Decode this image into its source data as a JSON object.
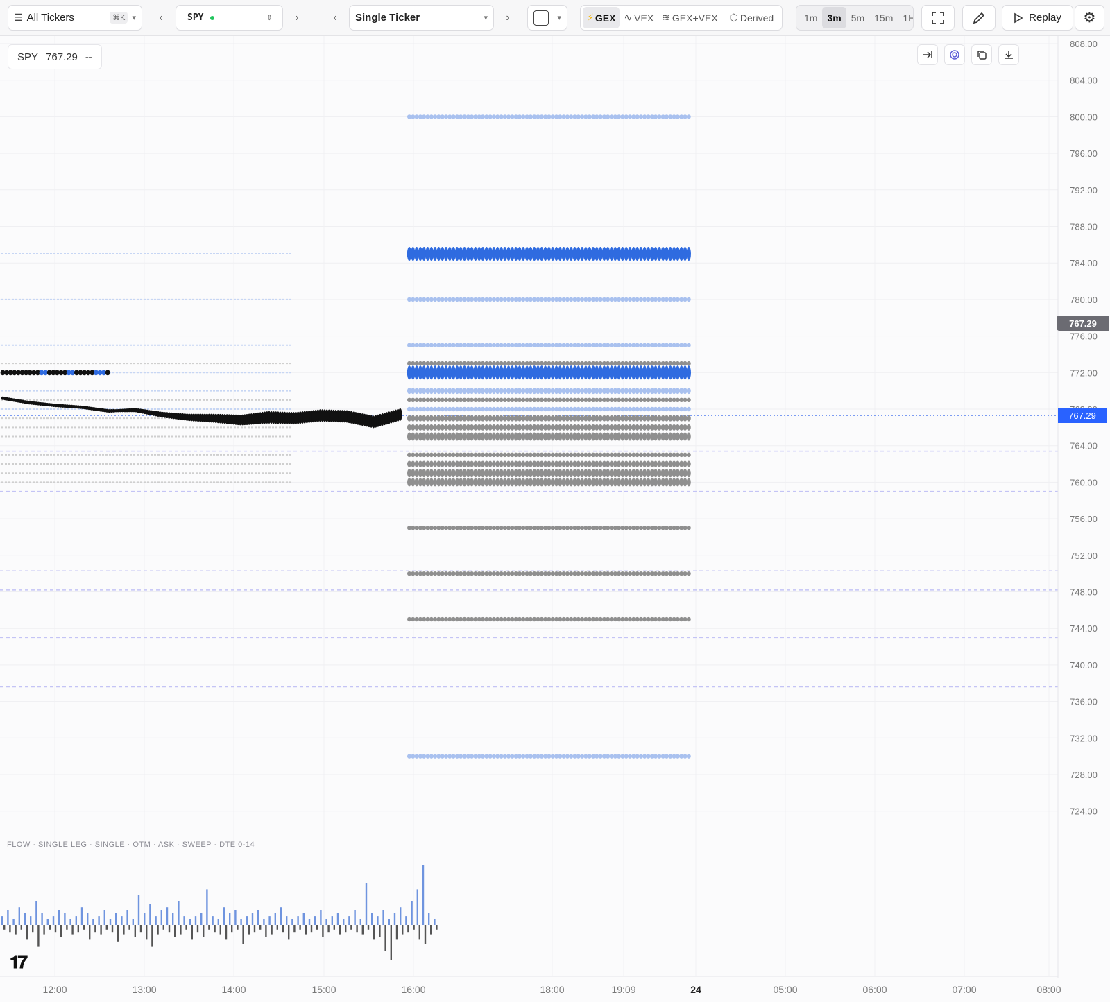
{
  "toolbar": {
    "tickers_label": "All Tickers",
    "tickers_shortcut": "⌘K",
    "symbol": "SPY",
    "view_mode": "Single Ticker",
    "modes": [
      "GEX",
      "VEX",
      "GEX+VEX",
      "Derived"
    ],
    "active_mode": "GEX",
    "timeframes": [
      "1m",
      "3m",
      "5m",
      "15m",
      "1H"
    ],
    "active_timeframe": "3m",
    "replay_label": "Replay"
  },
  "legend": {
    "symbol": "SPY",
    "price": "767.29",
    "change": "--"
  },
  "price_tag_last": "767.29",
  "price_tag_current": "767.29",
  "flow_label": "FLOW · SINGLE LEG · SINGLE · OTM · ASK · SWEEP · DTE 0-14",
  "logo_text": "TV",
  "colors": {
    "accent_blue": "#2962ff",
    "gex_positive_strong": "#2f6be0",
    "gex_positive_light": "#a9c1ef",
    "gex_negative": "#8f8f8f",
    "price_line": "#111111",
    "flow_call": "#6f94df",
    "flow_put": "#555555"
  },
  "chart_data": {
    "type": "scatter",
    "y_axis_ticks": [
      "808.00",
      "804.00",
      "800.00",
      "796.00",
      "792.00",
      "788.00",
      "784.00",
      "780.00",
      "776.00",
      "772.00",
      "768.00",
      "764.00",
      "760.00",
      "756.00",
      "752.00",
      "748.00",
      "744.00",
      "740.00",
      "736.00",
      "732.00",
      "728.00",
      "724.00"
    ],
    "x_axis_ticks": [
      "12:00",
      "13:00",
      "14:00",
      "15:00",
      "16:00",
      "18:00",
      "19:09",
      "24",
      "05:00",
      "06:00",
      "07:00",
      "08:00"
    ],
    "ylim": [
      720,
      810
    ],
    "current_price": 767.29,
    "dashed_levels": [
      763.4,
      759.0,
      750.3,
      748.2,
      743.0,
      737.6
    ],
    "gex_levels": [
      {
        "strike": 800,
        "sign": "pos",
        "size": 2
      },
      {
        "strike": 785,
        "sign": "pos",
        "size": 5
      },
      {
        "strike": 780,
        "sign": "pos",
        "size": 2
      },
      {
        "strike": 775,
        "sign": "pos",
        "size": 2
      },
      {
        "strike": 773,
        "sign": "neg",
        "size": 2
      },
      {
        "strike": 772,
        "sign": "pos",
        "size": 5
      },
      {
        "strike": 770,
        "sign": "pos",
        "size": 3
      },
      {
        "strike": 769,
        "sign": "neg",
        "size": 2
      },
      {
        "strike": 768,
        "sign": "pos",
        "size": 2
      },
      {
        "strike": 767,
        "sign": "neg",
        "size": 3
      },
      {
        "strike": 766,
        "sign": "neg",
        "size": 3
      },
      {
        "strike": 765,
        "sign": "neg",
        "size": 4
      },
      {
        "strike": 763,
        "sign": "neg",
        "size": 2
      },
      {
        "strike": 762,
        "sign": "neg",
        "size": 3
      },
      {
        "strike": 761,
        "sign": "neg",
        "size": 4
      },
      {
        "strike": 760,
        "sign": "neg",
        "size": 4
      },
      {
        "strike": 755,
        "sign": "neg",
        "size": 2
      },
      {
        "strike": 750,
        "sign": "neg",
        "size": 2
      },
      {
        "strike": 745,
        "sign": "neg",
        "size": 2
      },
      {
        "strike": 730,
        "sign": "pos",
        "size": 2
      }
    ],
    "price_path": [
      769.2,
      768.7,
      768.4,
      768.2,
      767.8,
      767.9,
      767.4,
      767.1,
      767.0,
      766.8,
      767.1,
      767.0,
      767.3,
      767.2,
      766.6,
      767.4
    ],
    "flow_series": {
      "call": [
        3,
        5,
        2,
        6,
        4,
        3,
        8,
        4,
        2,
        3,
        5,
        4,
        2,
        3,
        6,
        4,
        2,
        3,
        5,
        2,
        4,
        3,
        5,
        2,
        10,
        4,
        7,
        3,
        5,
        6,
        4,
        8,
        3,
        2,
        3,
        4,
        12,
        3,
        2,
        6,
        4,
        5,
        2,
        3,
        4,
        5,
        2,
        3,
        4,
        6,
        3,
        2,
        3,
        4,
        2,
        3,
        5,
        2,
        3,
        4,
        2,
        3,
        5,
        2,
        14,
        4,
        3,
        5,
        2,
        4,
        6,
        3,
        8,
        12,
        20,
        4,
        2
      ],
      "put": [
        2,
        3,
        4,
        2,
        6,
        3,
        9,
        4,
        2,
        3,
        5,
        2,
        4,
        3,
        2,
        6,
        3,
        4,
        2,
        3,
        7,
        4,
        2,
        5,
        3,
        6,
        9,
        4,
        2,
        3,
        5,
        4,
        2,
        6,
        3,
        5,
        2,
        3,
        4,
        6,
        3,
        2,
        8,
        4,
        3,
        2,
        5,
        4,
        2,
        3,
        6,
        3,
        2,
        4,
        3,
        2,
        5,
        3,
        2,
        4,
        3,
        2,
        3,
        4,
        2,
        6,
        5,
        11,
        15,
        6,
        4,
        3,
        2,
        6,
        8,
        4,
        2
      ]
    }
  }
}
